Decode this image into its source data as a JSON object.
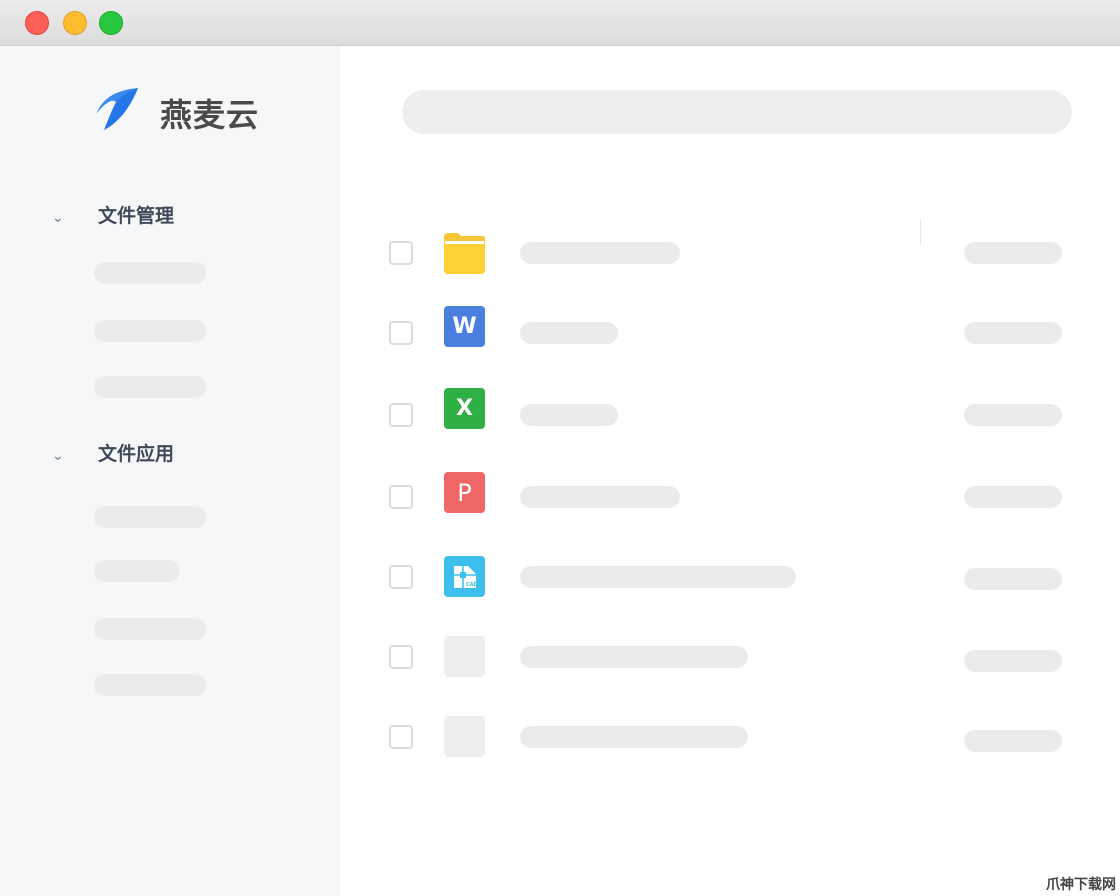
{
  "window": {
    "controls": [
      "close",
      "minimize",
      "maximize"
    ]
  },
  "brand": {
    "name": "燕麦云"
  },
  "sidebar": {
    "sections": [
      {
        "label": "文件管理",
        "chevron": "⌄"
      },
      {
        "label": "文件应用",
        "chevron": "⌄"
      }
    ]
  },
  "files": [
    {
      "type": "folder",
      "letter": ""
    },
    {
      "type": "word",
      "letter": "W",
      "color": "#4a7fe0"
    },
    {
      "type": "excel",
      "letter": "X",
      "color": "#2eb045"
    },
    {
      "type": "powerpoint",
      "letter": "P",
      "color": "#f06565"
    },
    {
      "type": "cad",
      "letter": "CAD",
      "color": "#3cbfec"
    },
    {
      "type": "placeholder",
      "letter": ""
    },
    {
      "type": "placeholder",
      "letter": ""
    }
  ],
  "watermark": "爪神下载网"
}
